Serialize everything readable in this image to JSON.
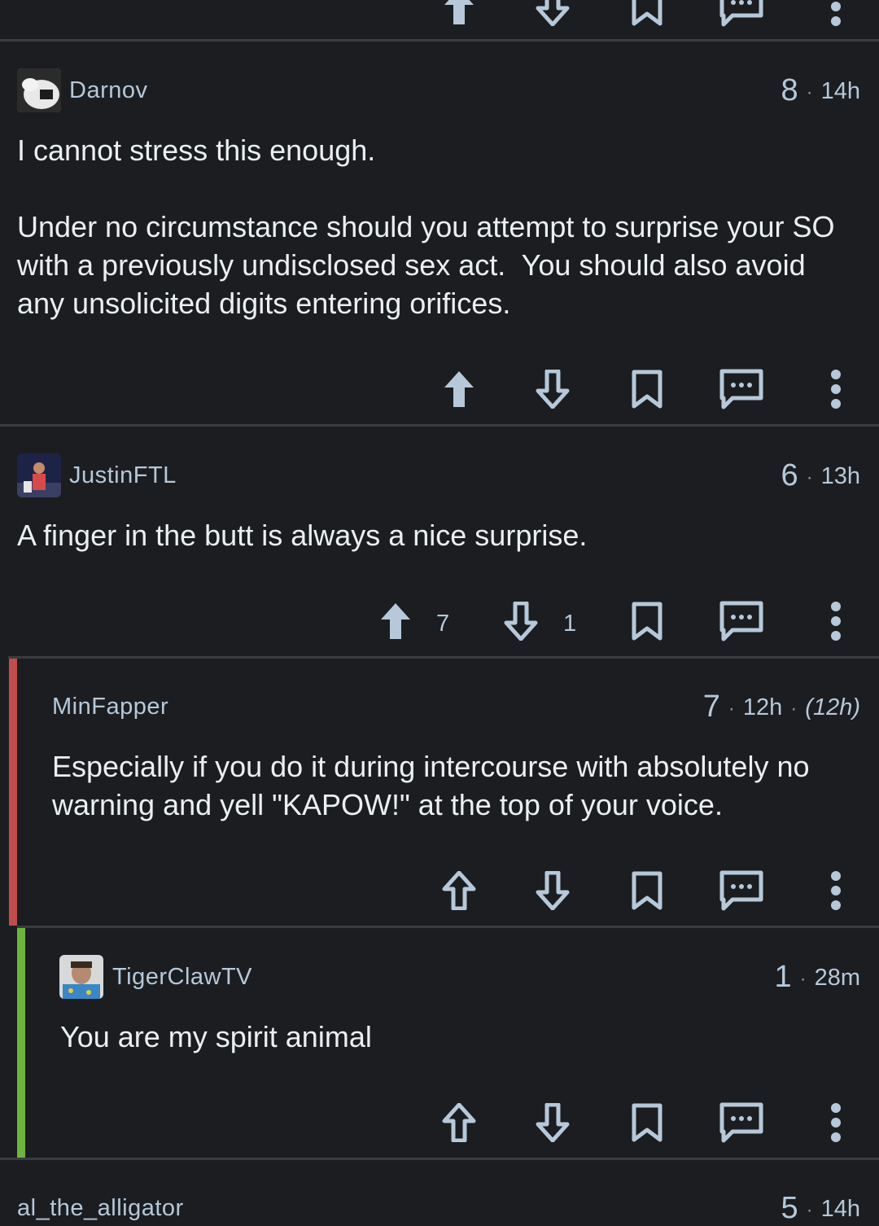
{
  "colors": {
    "background": "#1b1d21",
    "divider": "#3a3c40",
    "icon": "#b6c8d9",
    "rail_level1": "#c14c4c",
    "rail_level2": "#6fb43f"
  },
  "comments": [
    {
      "username": "Darnov",
      "score": "8",
      "age": "14h",
      "body": "I cannot stress this enough.\n\nUnder no circumstance should you attempt to surprise your SO with a previously undisclosed sex act.  You should also avoid any unsolicited digits entering orifices.",
      "upvote_active": true
    },
    {
      "username": "JustinFTL",
      "score": "6",
      "age": "13h",
      "body": "A finger in the butt is always a nice surprise.",
      "upvote_active": true,
      "upvote_count": "7",
      "downvote_count": "1"
    },
    {
      "username": "MinFapper",
      "score": "7",
      "age": "12h",
      "edited": "(12h)",
      "body": "Especially if you do it during intercourse with absolutely no warning and yell \"KAPOW!\" at the top of your voice.",
      "upvote_active": false
    },
    {
      "username": "TigerClawTV",
      "score": "1",
      "age": "28m",
      "body": "You are my spirit animal",
      "upvote_active": false
    },
    {
      "username": "al_the_alligator",
      "score": "5",
      "age": "14h"
    }
  ],
  "icons": {
    "upvote": "arrow-up-icon",
    "downvote": "arrow-down-icon",
    "save": "bookmark-icon",
    "reply": "comment-bubble-icon",
    "more": "more-vertical-icon"
  }
}
